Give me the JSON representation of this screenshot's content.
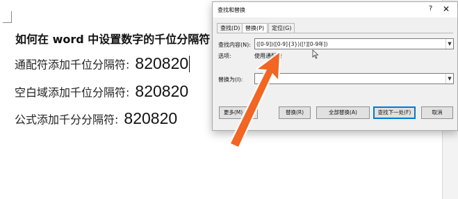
{
  "document": {
    "title": "如何在 word 中设置数字的千位分隔符",
    "rows": [
      {
        "label": "通配符添加千位分隔符:",
        "value": "820820"
      },
      {
        "label": "空白域添加千位分隔符:",
        "value": "820820"
      },
      {
        "label": "公式添加千分分隔符:",
        "value": "820820"
      }
    ]
  },
  "dialog": {
    "title": "查找和替换",
    "help": "?",
    "close": "✕",
    "tabs": [
      {
        "label": "查找(D)"
      },
      {
        "label": "替换(P)"
      },
      {
        "label": "定位(G)"
      }
    ],
    "find_label": "查找内容(N):",
    "find_value": "([0-9])([0-9]{3})([!][0-9年])",
    "options_label": "选项:",
    "options_value": "使用通配符",
    "replace_label": "替换为(I):",
    "replace_value": "",
    "buttons": {
      "more": "更多(M) >>",
      "replace": "替换(R)",
      "replace_all": "全部替换(A)",
      "find_next": "查找下一处(F)",
      "cancel": "取消"
    }
  },
  "colors": {
    "arrow": "#f26522",
    "focus": "#0078d7"
  }
}
